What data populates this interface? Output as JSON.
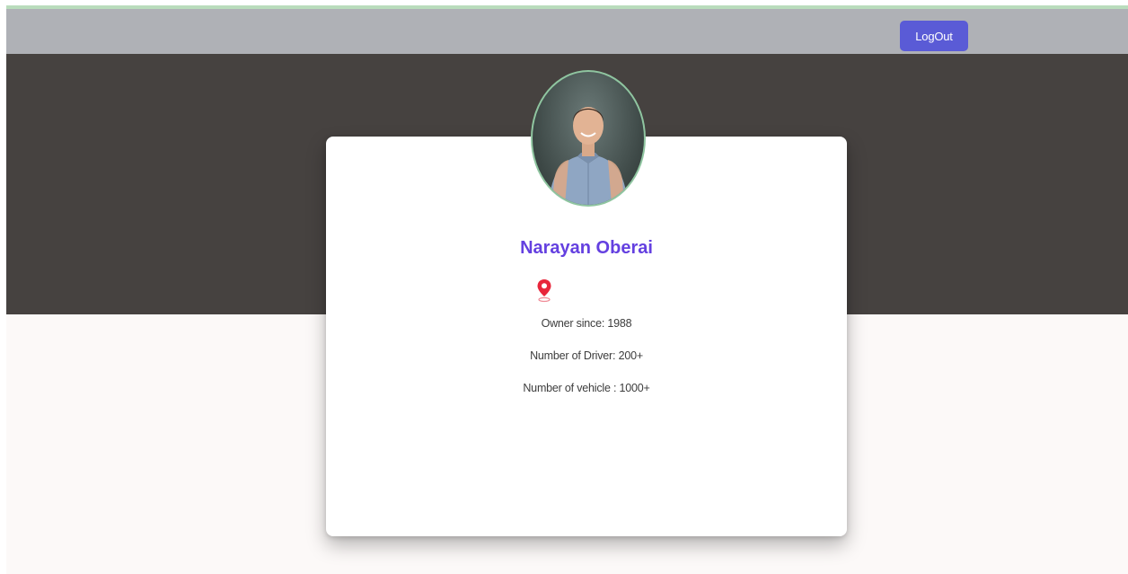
{
  "header": {
    "logout_label": "LogOut"
  },
  "profile": {
    "name": "Narayan Oberai",
    "location_icon": "location-pin-icon",
    "owner_since": "Owner since: 1988",
    "drivers": "Number of Driver: 200+",
    "vehicles": "Number of vehicle : 1000+"
  },
  "colors": {
    "navbar": "#afb1b6",
    "hero": "#464240",
    "accent_button": "#5a5bd6",
    "name_text": "#6440e0",
    "pin": "#e8263b"
  }
}
